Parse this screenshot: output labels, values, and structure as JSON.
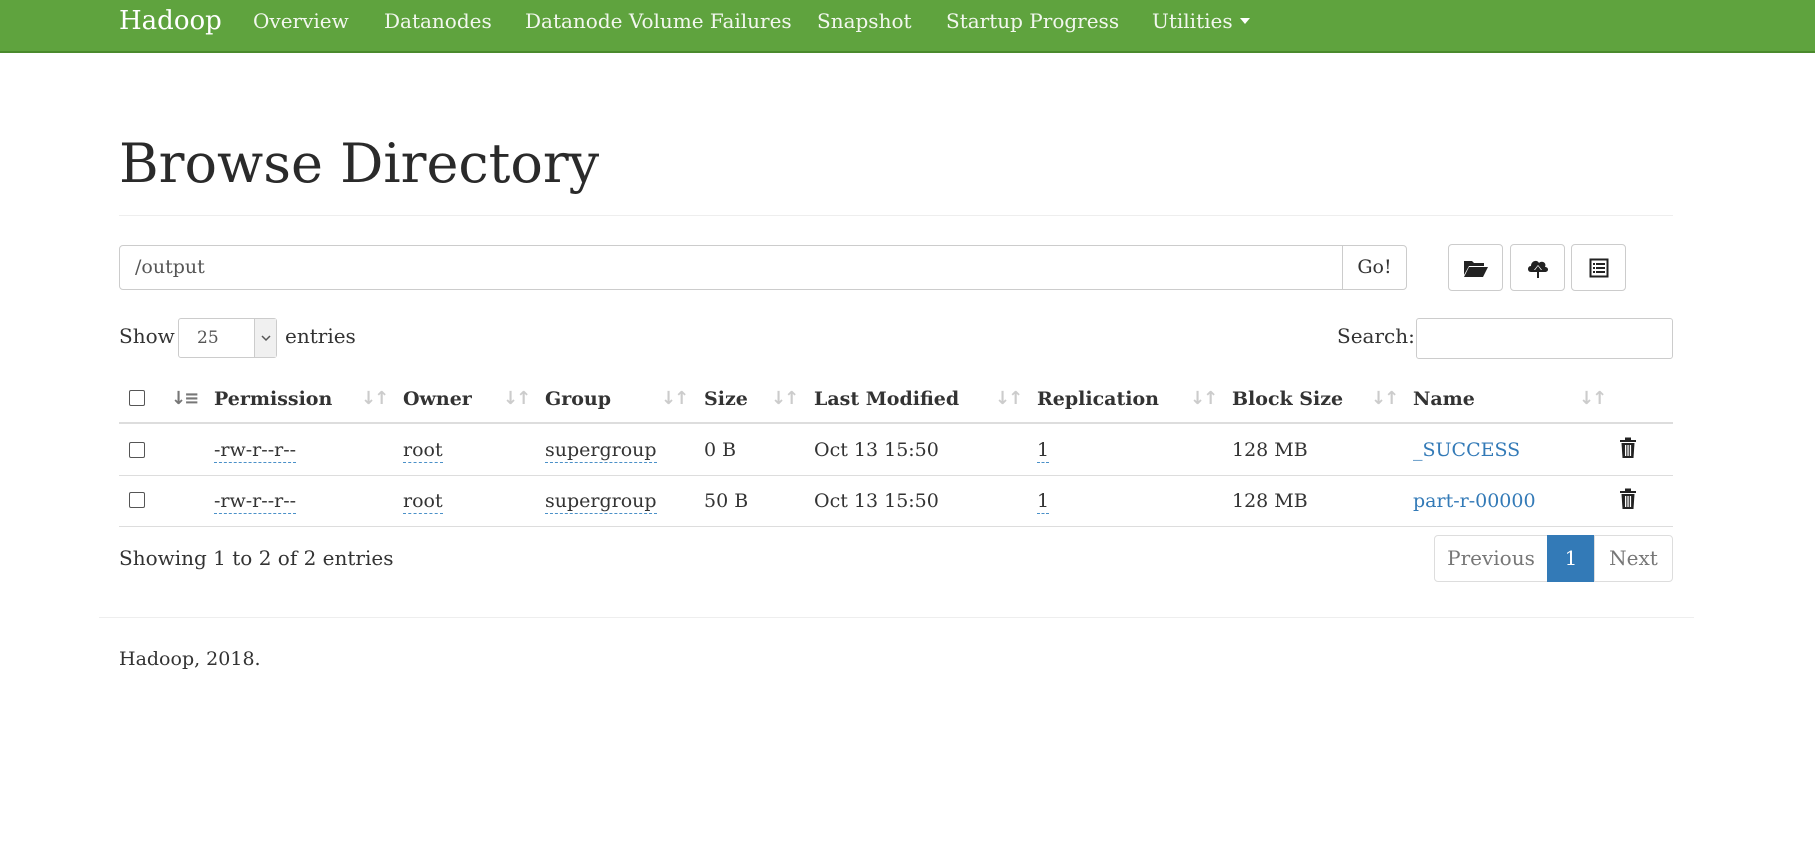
{
  "navbar": {
    "brand": "Hadoop",
    "links": [
      "Overview",
      "Datanodes",
      "Datanode Volume Failures",
      "Snapshot",
      "Startup Progress"
    ],
    "utilities": "Utilities",
    "bg_color": "#5fa33e"
  },
  "page": {
    "title": "Browse Directory"
  },
  "path_bar": {
    "value": "/output",
    "go_label": "Go!"
  },
  "toolbar_icons": [
    "folder-open-icon",
    "cloud-upload-icon",
    "list-alt-icon"
  ],
  "length": {
    "show": "Show",
    "selected": "25",
    "entries": "entries"
  },
  "search": {
    "label": "Search:",
    "value": ""
  },
  "table": {
    "columns": [
      "Permission",
      "Owner",
      "Group",
      "Size",
      "Last Modified",
      "Replication",
      "Block Size",
      "Name"
    ],
    "rows": [
      {
        "permission": "-rw-r--r--",
        "owner": "root",
        "group": "supergroup",
        "size": "0 B",
        "last_modified": "Oct 13 15:50",
        "replication": "1",
        "block_size": "128 MB",
        "name": "_SUCCESS"
      },
      {
        "permission": "-rw-r--r--",
        "owner": "root",
        "group": "supergroup",
        "size": "50 B",
        "last_modified": "Oct 13 15:50",
        "replication": "1",
        "block_size": "128 MB",
        "name": "part-r-00000"
      }
    ]
  },
  "info": "Showing 1 to 2 of 2 entries",
  "pagination": {
    "previous": "Previous",
    "current": "1",
    "next": "Next",
    "active_color": "#337ab7"
  },
  "footer": "Hadoop, 2018."
}
